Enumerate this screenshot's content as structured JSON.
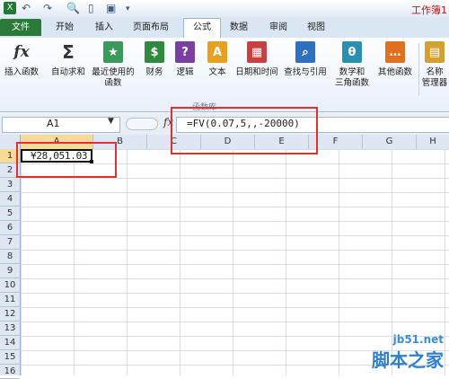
{
  "title_bar": {
    "title": "工作簿1",
    "icons": [
      "excel-app-icon",
      "undo-icon",
      "redo-icon",
      "print-preview-icon",
      "new-doc-icon",
      "save-icon",
      "customize-icon"
    ]
  },
  "tabs": [
    "文件",
    "开始",
    "插入",
    "页面布局",
    "公式",
    "数据",
    "审阅",
    "视图"
  ],
  "active_tab": "公式",
  "ribbon": {
    "buttons": [
      {
        "line1": "插入函数",
        "line2": "",
        "icon": "fx-icon",
        "color": "#ffffff"
      },
      {
        "line1": "自动求和",
        "line2": "",
        "icon": "sigma-icon",
        "color": "#ffffff"
      },
      {
        "line1": "最近使用的",
        "line2": "函数",
        "icon": "star-book-icon",
        "color": "#3a9a5a"
      },
      {
        "line1": "财务",
        "line2": "",
        "icon": "finance-book-icon",
        "color": "#2e8b3e"
      },
      {
        "line1": "逻辑",
        "line2": "",
        "icon": "logic-book-icon",
        "color": "#7a3fa0"
      },
      {
        "line1": "文本",
        "line2": "",
        "icon": "text-book-icon",
        "color": "#e8a020"
      },
      {
        "line1": "日期和时间",
        "line2": "",
        "icon": "date-book-icon",
        "color": "#c84040"
      },
      {
        "line1": "查找与引用",
        "line2": "",
        "icon": "lookup-book-icon",
        "color": "#2f6fc0"
      },
      {
        "line1": "数学和",
        "line2": "三角函数",
        "icon": "math-book-icon",
        "color": "#2a8fb0"
      },
      {
        "line1": "其他函数",
        "line2": "",
        "icon": "more-book-icon",
        "color": "#e07020"
      },
      {
        "line1": "名称",
        "line2": "管理器",
        "icon": "name-manager-icon",
        "color": "#d4a030"
      }
    ],
    "group_label": "函数库"
  },
  "formula_bar": {
    "name_box": "A1",
    "fx_label": "fx",
    "formula": "=FV(0.07,5,,-20000)"
  },
  "grid": {
    "columns": [
      "A",
      "B",
      "C",
      "D",
      "E",
      "F",
      "G",
      "H"
    ],
    "rows": [
      "1",
      "2",
      "3",
      "4",
      "5",
      "6",
      "7",
      "8",
      "9",
      "10",
      "11",
      "12",
      "13",
      "14",
      "15",
      "16"
    ],
    "cell_a1": "¥28,051.03"
  },
  "watermark": {
    "line1": "jb51.net",
    "line2": "脚本之家"
  }
}
